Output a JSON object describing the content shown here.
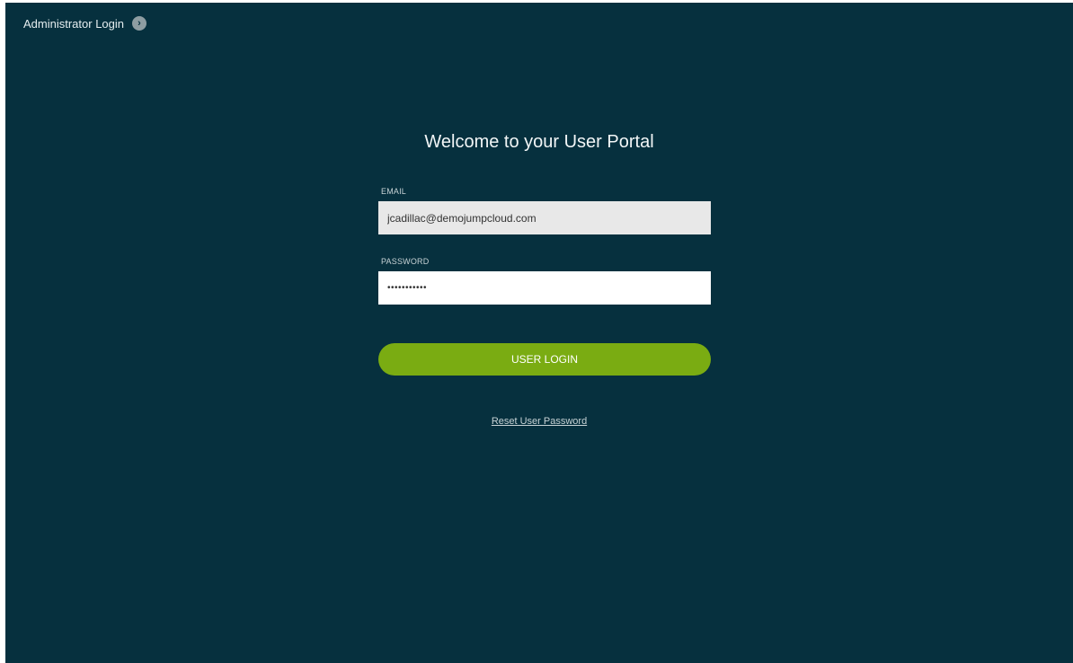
{
  "header": {
    "admin_login_label": "Administrator Login",
    "admin_login_icon": "chevron-right-circle-icon"
  },
  "login": {
    "title": "Welcome to your User Portal",
    "email_label": "EMAIL",
    "email_value": "jcadillac@demojumpcloud.com",
    "password_label": "PASSWORD",
    "password_value": "•••••••••••",
    "submit_label": "USER LOGIN",
    "reset_label": "Reset User Password"
  },
  "colors": {
    "background": "#06303e",
    "accent": "#7aac12"
  }
}
